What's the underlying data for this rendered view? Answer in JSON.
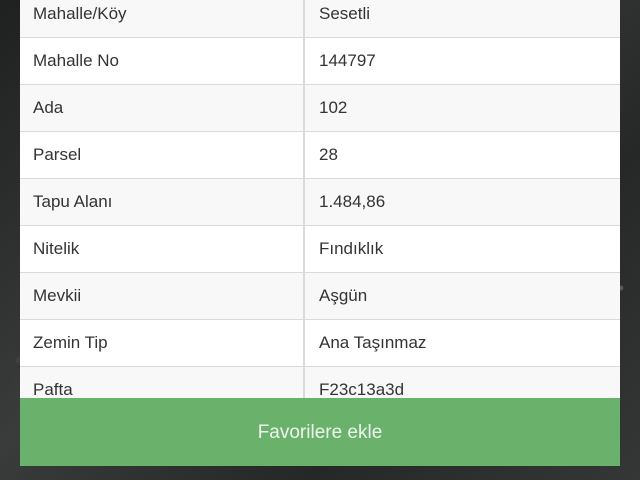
{
  "table": {
    "rows": [
      {
        "label": "Mahalle/Köy",
        "value": "Sesetli"
      },
      {
        "label": "Mahalle No",
        "value": "144797"
      },
      {
        "label": "Ada",
        "value": "102"
      },
      {
        "label": "Parsel",
        "value": "28"
      },
      {
        "label": "Tapu Alanı",
        "value": "1.484,86"
      },
      {
        "label": "Nitelik",
        "value": "Fındıklık"
      },
      {
        "label": "Mevkii",
        "value": "Aşgün"
      },
      {
        "label": "Zemin Tip",
        "value": "Ana Taşınmaz"
      },
      {
        "label": "Pafta",
        "value": "F23c13a3d"
      }
    ]
  },
  "actions": {
    "favorite_label": "Favorilere ekle"
  },
  "colors": {
    "button_green": "#6ab26b",
    "row_alt": "#f8f8f8",
    "border": "#dadada"
  }
}
